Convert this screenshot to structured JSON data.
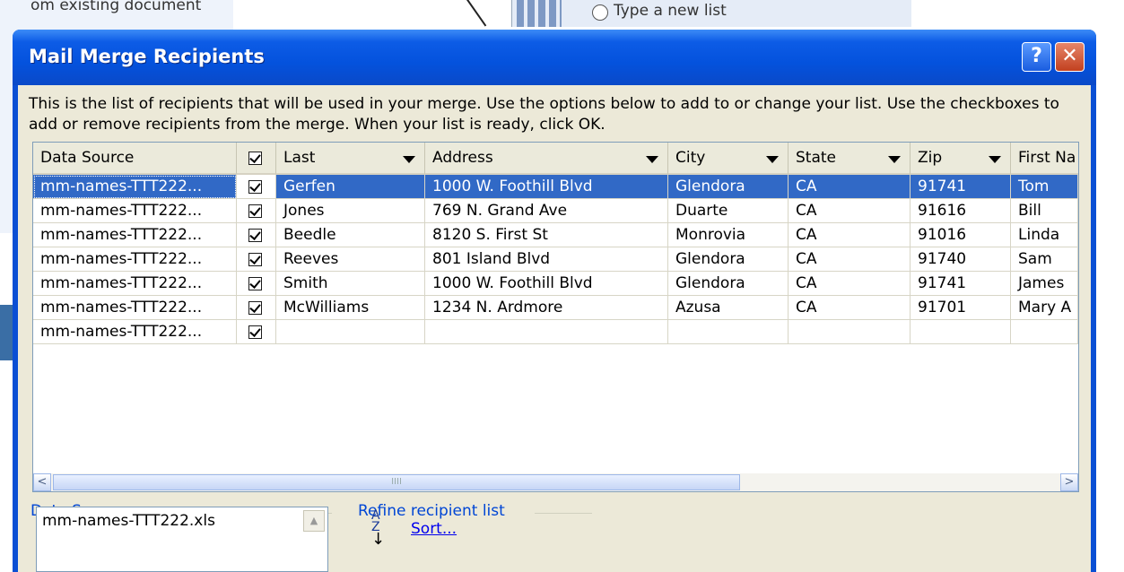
{
  "background": {
    "doc_text": "om existing document",
    "radio_label": "Type a new list"
  },
  "dialog": {
    "title": "Mail Merge Recipients",
    "help_label": "?",
    "close_label": "✕",
    "instructions": "This is the list of recipients that will be used in your merge.  Use the options below to add to or change your list.  Use the checkboxes to add or remove recipients from the merge.  When your list is ready, click OK."
  },
  "grid": {
    "columns": [
      "Data Source",
      "",
      "Last",
      "Address",
      "City",
      "State",
      "Zip",
      "First Na"
    ],
    "rows": [
      {
        "source": "mm-names-TTT222...",
        "checked": true,
        "last": "Gerfen",
        "address": "1000 W. Foothill Blvd",
        "city": "Glendora",
        "state": "CA",
        "zip": "91741",
        "first": "Tom"
      },
      {
        "source": "mm-names-TTT222...",
        "checked": true,
        "last": "Jones",
        "address": "769 N. Grand Ave",
        "city": "Duarte",
        "state": "CA",
        "zip": "91616",
        "first": "Bill"
      },
      {
        "source": "mm-names-TTT222...",
        "checked": true,
        "last": "Beedle",
        "address": "8120 S. First St",
        "city": "Monrovia",
        "state": "CA",
        "zip": "91016",
        "first": "Linda"
      },
      {
        "source": "mm-names-TTT222...",
        "checked": true,
        "last": "Reeves",
        "address": "801 Island Blvd",
        "city": "Glendora",
        "state": "CA",
        "zip": "91740",
        "first": "Sam"
      },
      {
        "source": "mm-names-TTT222...",
        "checked": true,
        "last": "Smith",
        "address": "1000 W. Foothill Blvd",
        "city": "Glendora",
        "state": "CA",
        "zip": "91741",
        "first": "James"
      },
      {
        "source": "mm-names-TTT222...",
        "checked": true,
        "last": "McWilliams",
        "address": "1234 N. Ardmore",
        "city": "Azusa",
        "state": "CA",
        "zip": "91701",
        "first": "Mary A"
      },
      {
        "source": "mm-names-TTT222...",
        "checked": true,
        "last": "",
        "address": "",
        "city": "",
        "state": "",
        "zip": "",
        "first": ""
      }
    ],
    "scroll_left": "<",
    "scroll_right": ">",
    "scroll_thumb_grip": "IIII"
  },
  "data_source_group": {
    "label": "Data Source",
    "items": [
      "mm-names-TTT222.xls"
    ],
    "up_arrow": "▲"
  },
  "refine_group": {
    "label": "Refine recipient list",
    "sort_icon_top": "A",
    "sort_icon_bottom": "Z",
    "sort_icon_arrow": "↓",
    "sort_label": "Sort..."
  }
}
